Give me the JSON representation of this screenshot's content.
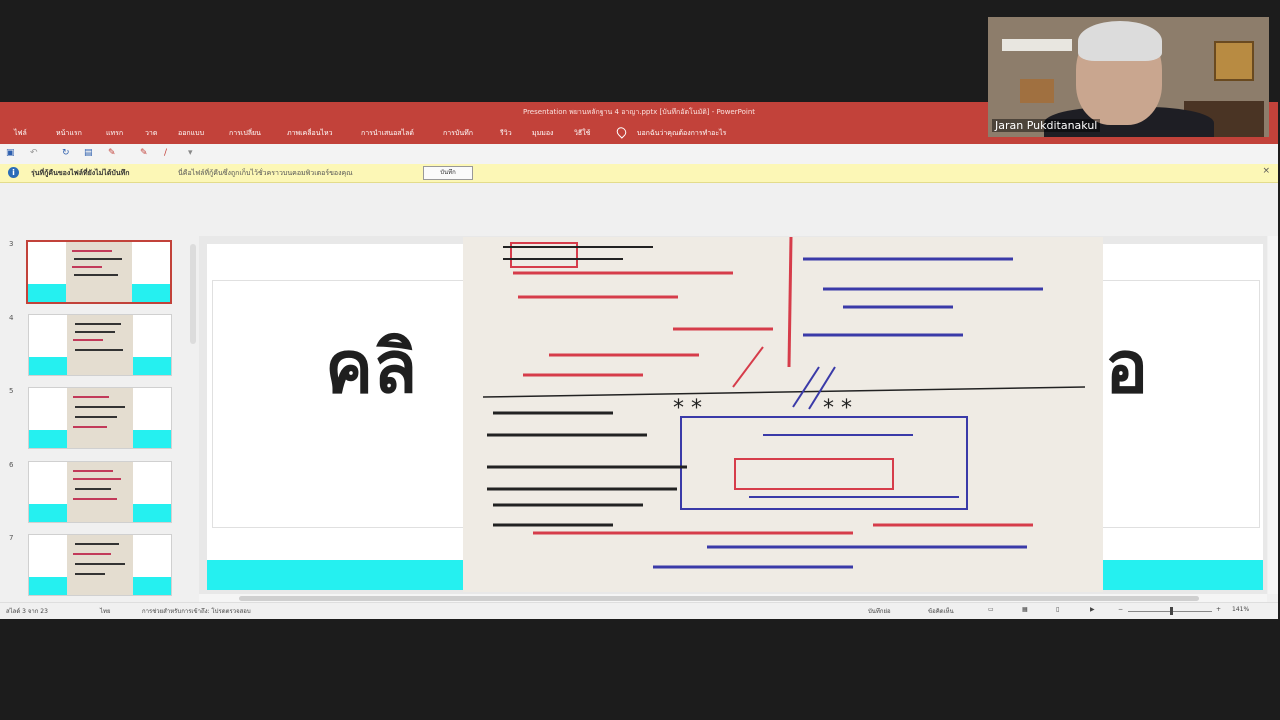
{
  "window": {
    "title": "Presentation พยานหลักฐาน 4 อาญา.pptx [บันทึกอัตโนมัติ] - PowerPoint"
  },
  "ribbon": {
    "tabs": [
      "ไฟล์",
      "หน้าแรก",
      "แทรก",
      "วาด",
      "ออกแบบ",
      "การเปลี่ยน",
      "ภาพเคลื่อนไหว",
      "การนำเสนอสไลด์",
      "การบันทึก",
      "รีวิว",
      "มุมมอง",
      "วิธีใช้"
    ],
    "search_hint": "บอกฉันว่าคุณต้องการทำอะไร"
  },
  "infobar": {
    "title": "รุ่นที่กู้คืนของไฟล์ที่ยังไม่ได้บันทึก",
    "message": "นี่คือไฟล์ที่กู้คืนซึ่งถูกเก็บไว้ชั่วคราวบนคอมพิวเตอร์ของคุณ",
    "button": "บันทึก"
  },
  "slides": {
    "items": [
      {
        "num": "3",
        "selected": true
      },
      {
        "num": "4",
        "selected": false
      },
      {
        "num": "5",
        "selected": false
      },
      {
        "num": "6",
        "selected": false
      },
      {
        "num": "7",
        "selected": false
      }
    ]
  },
  "slide": {
    "title_left": "คลิ",
    "title_right": "อ"
  },
  "status": {
    "slide_count": "สไลด์ 3 จาก 23",
    "lang": "ไทย",
    "accessibility": "การช่วยสำหรับการเข้าถึง: โปรดตรวจสอบ",
    "notes": "บันทึกย่อ",
    "comments": "ข้อคิดเห็น",
    "zoom": "141%"
  },
  "webcam": {
    "name": "Jaran Pukditanakul"
  },
  "colors": {
    "accent": "#c2423a",
    "slide_bar": "#25f0f0"
  }
}
